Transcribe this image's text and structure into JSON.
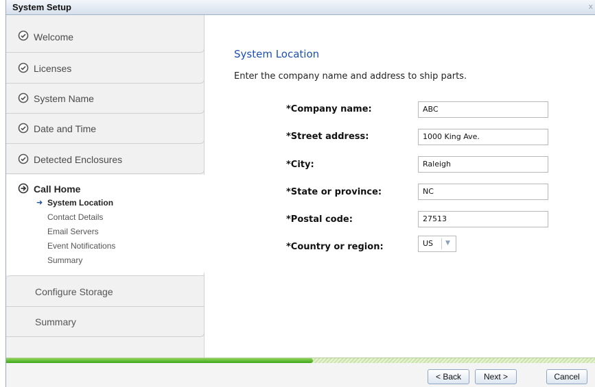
{
  "window": {
    "title": "System Setup",
    "close_label": "x"
  },
  "sidebar": {
    "steps": [
      {
        "label": "Welcome"
      },
      {
        "label": "Licenses"
      },
      {
        "label": "System Name"
      },
      {
        "label": "Date and Time"
      },
      {
        "label": "Detected Enclosures"
      }
    ],
    "active_step": {
      "label": "Call Home",
      "substeps": [
        {
          "label": "System Location"
        },
        {
          "label": "Contact Details"
        },
        {
          "label": "Email Servers"
        },
        {
          "label": "Event Notifications"
        },
        {
          "label": "Summary"
        }
      ]
    },
    "pending_steps": [
      {
        "label": "Configure Storage"
      },
      {
        "label": "Summary"
      }
    ]
  },
  "content": {
    "heading": "System Location",
    "intro": "Enter the company name and address to ship parts.",
    "fields": [
      {
        "label": "*Company name:",
        "value": "ABC"
      },
      {
        "label": "*Street address:",
        "value": "1000 King Ave."
      },
      {
        "label": "*City:",
        "value": "Raleigh"
      },
      {
        "label": "*State or province:",
        "value": "NC"
      },
      {
        "label": "*Postal code:",
        "value": "27513"
      }
    ],
    "country": {
      "label": "*Country or region:",
      "value": "US"
    }
  },
  "progress": {
    "fraction": 0.52
  },
  "footer": {
    "back_label": "< Back",
    "next_label": "Next >",
    "cancel_label": "Cancel"
  },
  "colors": {
    "accent": "#1a4fb0",
    "progress": "#3da618",
    "title_bar": "#d6e0ec"
  }
}
